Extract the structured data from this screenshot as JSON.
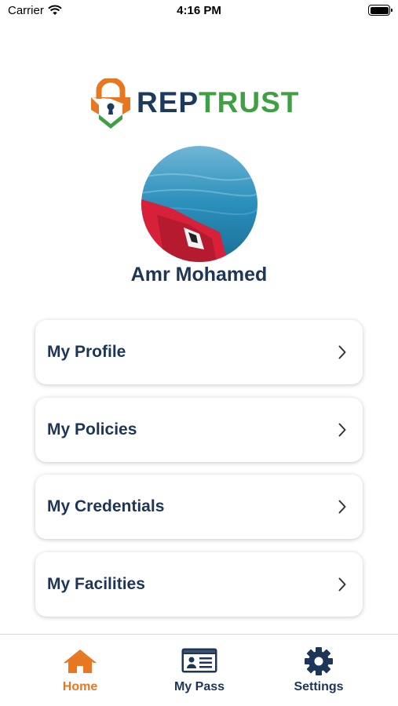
{
  "status_bar": {
    "carrier": "Carrier",
    "time": "4:16 PM"
  },
  "logo": {
    "part1": "REP",
    "part2": "TRUST",
    "colors": {
      "rep": "#1d3a5c",
      "trust": "#3ea043",
      "lock": "#e87722"
    }
  },
  "user": {
    "name": "Amr Mohamed"
  },
  "menu": {
    "items": [
      {
        "label": "My Profile",
        "icon": "chevron-right-icon"
      },
      {
        "label": "My Policies",
        "icon": "chevron-right-icon"
      },
      {
        "label": "My Credentials",
        "icon": "chevron-right-icon"
      },
      {
        "label": "My Facilities",
        "icon": "chevron-right-icon"
      }
    ]
  },
  "tabs": [
    {
      "label": "Home",
      "icon": "home-icon",
      "active": true
    },
    {
      "label": "My Pass",
      "icon": "id-card-icon",
      "active": false
    },
    {
      "label": "Settings",
      "icon": "gear-icon",
      "active": false
    }
  ],
  "colors": {
    "accent": "#e87722",
    "primary": "#1d3557"
  }
}
